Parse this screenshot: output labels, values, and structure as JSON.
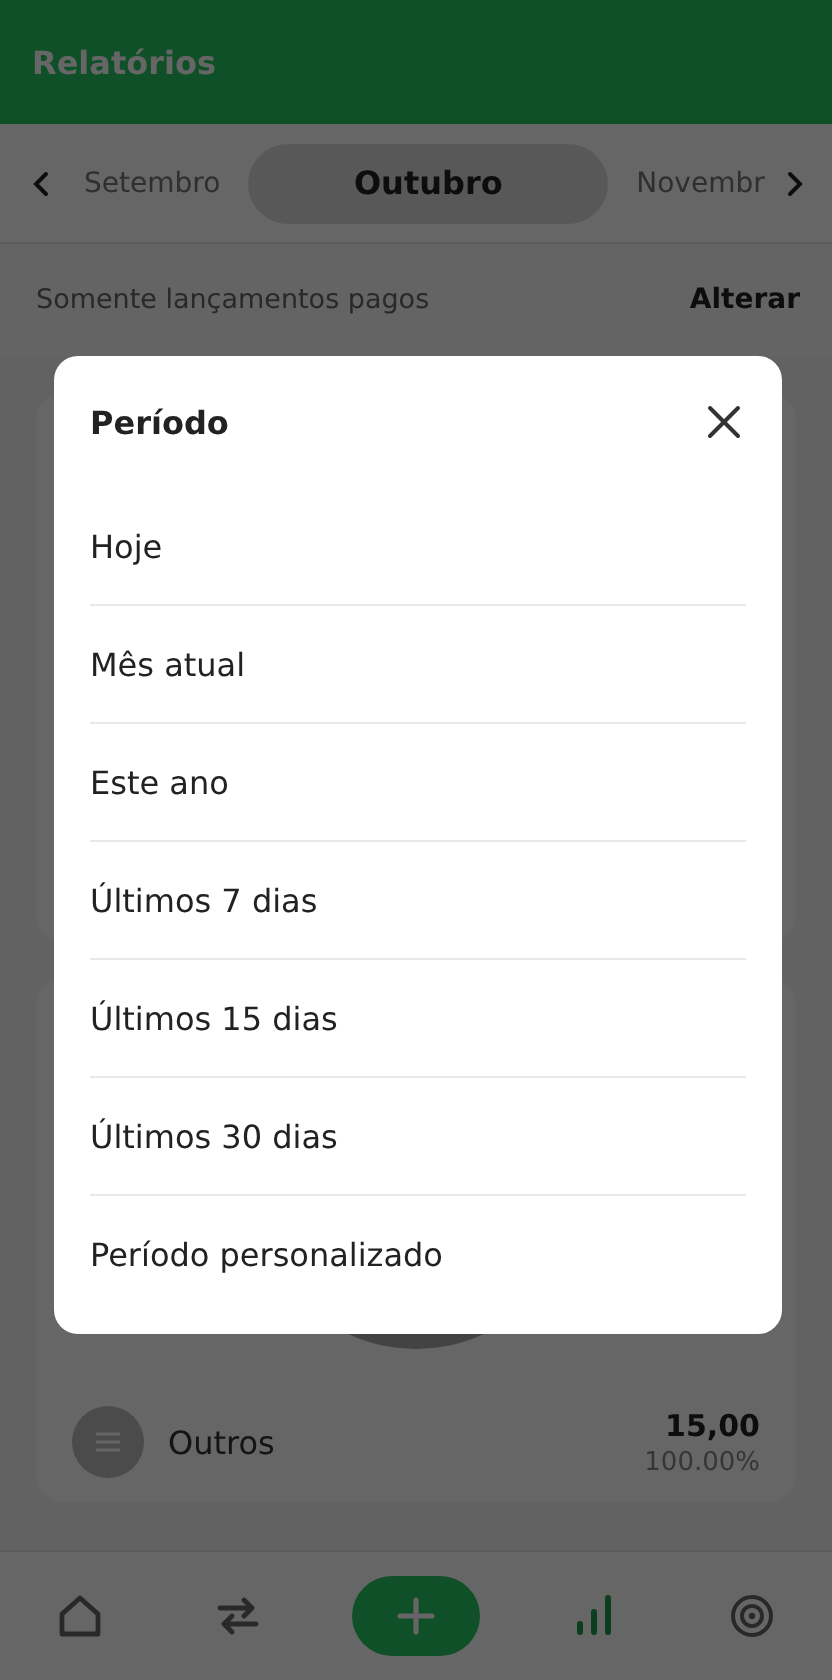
{
  "header": {
    "title": "Relatórios"
  },
  "months": [
    {
      "label": "Setembro",
      "selected": false
    },
    {
      "label": "Outubro",
      "selected": true
    },
    {
      "label": "Novembr",
      "selected": false
    }
  ],
  "filter": {
    "label": "Somente lançamentos pagos",
    "action": "Alterar"
  },
  "categories": [
    {
      "name": "Outros",
      "amount": "15,00",
      "percent": "100.00%"
    }
  ],
  "nav": [
    {
      "kind": "home",
      "selected": false
    },
    {
      "kind": "transfer",
      "selected": false
    },
    {
      "kind": "add",
      "selected": false
    },
    {
      "kind": "chart",
      "selected": true
    },
    {
      "kind": "target",
      "selected": false
    }
  ],
  "modal": {
    "title": "Período",
    "options": [
      {
        "label": "Hoje"
      },
      {
        "label": "Mês atual"
      },
      {
        "label": "Este ano"
      },
      {
        "label": "Últimos 7 dias"
      },
      {
        "label": "Últimos 15 dias"
      },
      {
        "label": "Últimos 30 dias"
      },
      {
        "label": "Período personalizado"
      }
    ]
  }
}
